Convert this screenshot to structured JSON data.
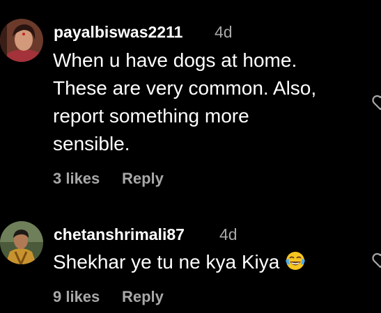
{
  "comments": [
    {
      "username": "payalbiswas2211",
      "time": "4d",
      "lines": [
        "When u have dogs at home.",
        "These are very common. Also,",
        "report something more",
        "sensible."
      ],
      "likes": "3 likes",
      "reply": "Reply",
      "avatar": "avatar-photo",
      "like_icon": "heart-outline-icon"
    },
    {
      "username": "chetanshrimali87",
      "time": "4d",
      "lines": [
        "Shekhar ye tu ne kya Kiya"
      ],
      "emoji": "tears-of-joy-emoji",
      "likes": "9 likes",
      "reply": "Reply",
      "avatar": "avatar-photo",
      "like_icon": "heart-outline-icon"
    }
  ],
  "colors": {
    "background": "#000000",
    "primary_text": "#ffffff",
    "secondary_text": "#a8a8a8",
    "icon": "#a8a8a8"
  }
}
